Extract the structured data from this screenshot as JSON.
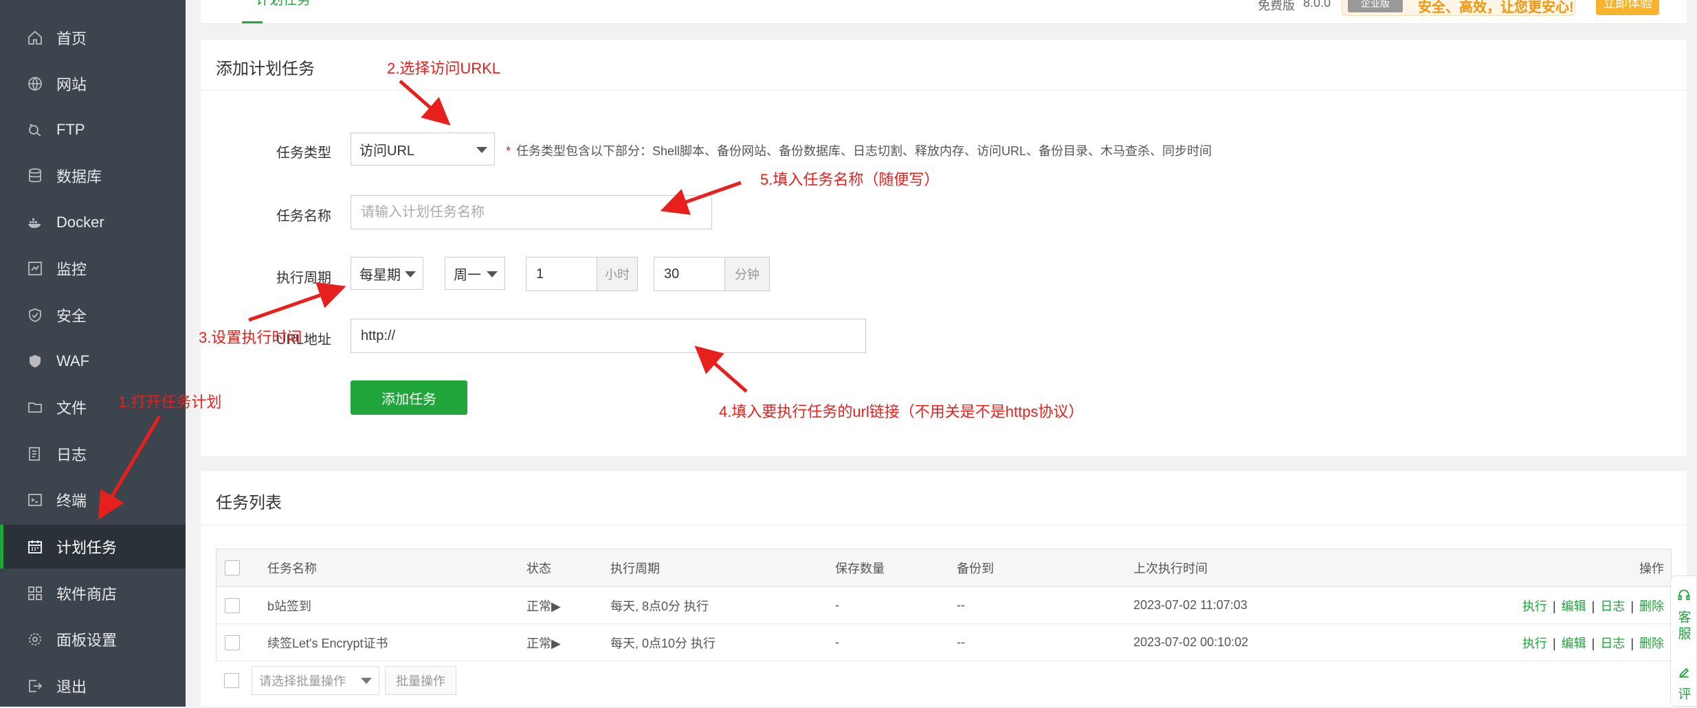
{
  "sidebar": {
    "items": [
      {
        "label": "首页",
        "icon": "home-icon"
      },
      {
        "label": "网站",
        "icon": "globe-icon"
      },
      {
        "label": "FTP",
        "icon": "ftp-icon"
      },
      {
        "label": "数据库",
        "icon": "database-icon"
      },
      {
        "label": "Docker",
        "icon": "docker-icon"
      },
      {
        "label": "监控",
        "icon": "monitor-icon"
      },
      {
        "label": "安全",
        "icon": "shield-icon"
      },
      {
        "label": "WAF",
        "icon": "waf-shield-icon"
      },
      {
        "label": "文件",
        "icon": "folder-icon"
      },
      {
        "label": "日志",
        "icon": "log-icon"
      },
      {
        "label": "终端",
        "icon": "terminal-icon"
      },
      {
        "label": "计划任务",
        "icon": "calendar-icon",
        "active": true
      },
      {
        "label": "软件商店",
        "icon": "grid-icon"
      },
      {
        "label": "面板设置",
        "icon": "gear-icon"
      },
      {
        "label": "退出",
        "icon": "logout-icon"
      }
    ]
  },
  "header": {
    "tab_label": "计划任务",
    "edition": "免费版",
    "version": "8.0.0",
    "promo_badge": "企业版",
    "promo_text": "安全、高效，让您更安心!",
    "promo_button": "立即体验"
  },
  "add_form": {
    "title": "添加计划任务",
    "type_label": "任务类型",
    "type_value": "访问URL",
    "type_note_required": "*",
    "type_note": "任务类型包含以下部分：Shell脚本、备份网站、备份数据库、日志切割、释放内存、访问URL、备份目录、木马查杀、同步时间",
    "name_label": "任务名称",
    "name_placeholder": "请输入计划任务名称",
    "period_label": "执行周期",
    "period_value": "每星期",
    "weekday_value": "周一",
    "hour_value": "1",
    "hour_unit": "小时",
    "minute_value": "30",
    "minute_unit": "分钟",
    "url_label": "URL地址",
    "url_value": "http://",
    "submit_label": "添加任务"
  },
  "task_list": {
    "title": "任务列表",
    "columns": [
      "任务名称",
      "状态",
      "执行周期",
      "保存数量",
      "备份到",
      "上次执行时间",
      "操作"
    ],
    "rows": [
      {
        "name": "b站签到",
        "status": "正常▶",
        "period": "每天, 8点0分 执行",
        "keep": "-",
        "backup": "--",
        "last_run": "2023-07-02 11:07:03"
      },
      {
        "name": "续签Let's Encrypt证书",
        "status": "正常▶",
        "period": "每天, 0点10分 执行",
        "keep": "-",
        "backup": "--",
        "last_run": "2023-07-02 00:10:02"
      }
    ],
    "actions": [
      "执行",
      "编辑",
      "日志",
      "删除"
    ],
    "action_separator": "|",
    "batch_placeholder": "请选择批量操作",
    "batch_button": "批量操作"
  },
  "float_widget": {
    "service_label_1": "客",
    "service_label_2": "服",
    "review_label": "评"
  },
  "annotations": {
    "step1": "1.打开任务计划",
    "step2": "2.选择访问URKL",
    "step3": "3.设置执行时间",
    "step4": "4.填入要执行任务的url链接（不用关是不是https协议）",
    "step5": "5.填入任务名称（随便写）",
    "color": "#e8201d"
  }
}
